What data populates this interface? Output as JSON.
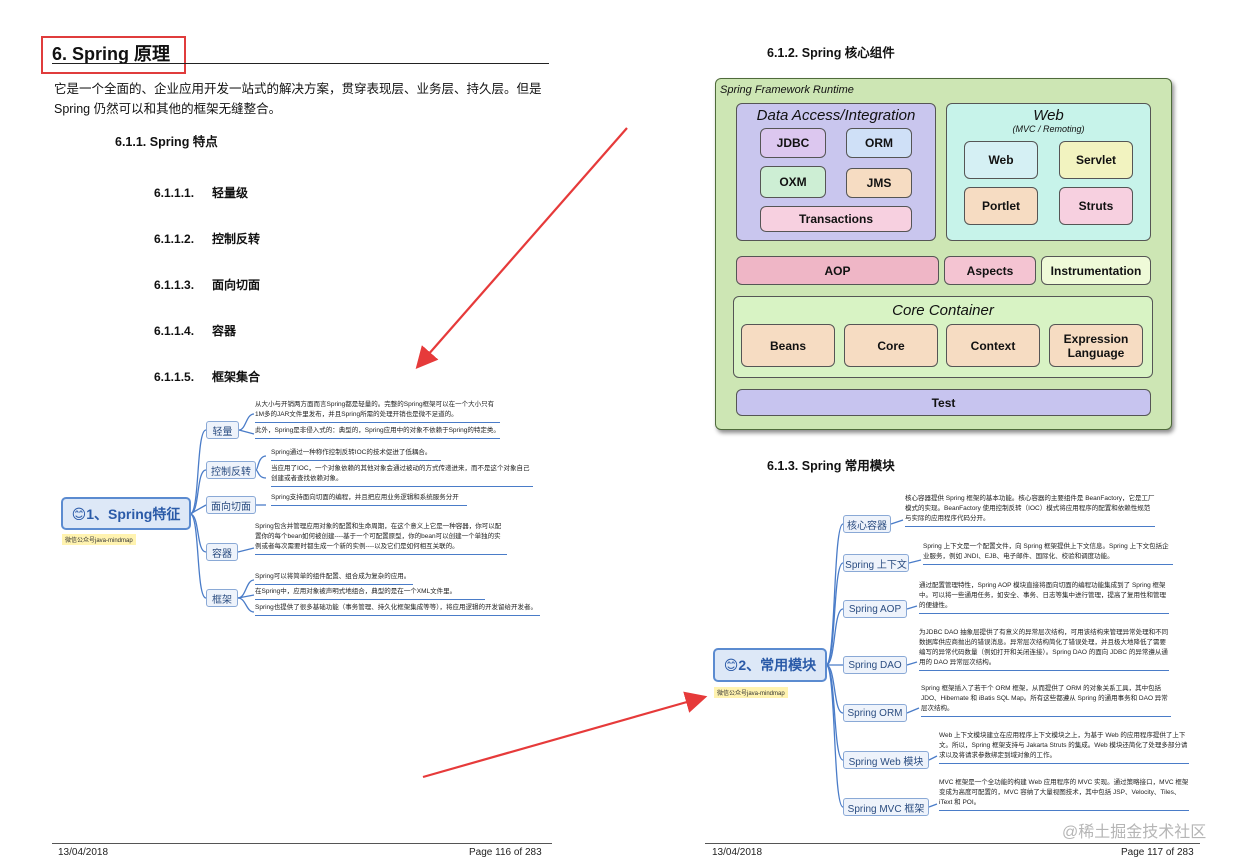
{
  "left_page": {
    "section_title": "6. Spring 原理",
    "intro": "它是一个全面的、企业应用开发一站式的解决方案，贯穿表现层、业务层、持久层。但是 Spring 仍然可以和其他的框架无缝整合。",
    "subsection": "6.1.1.  Spring 特点",
    "features": [
      {
        "num": "6.1.1.1.",
        "label": "轻量级"
      },
      {
        "num": "6.1.1.2.",
        "label": "控制反转"
      },
      {
        "num": "6.1.1.3.",
        "label": "面向切面"
      },
      {
        "num": "6.1.1.4.",
        "label": "容器"
      },
      {
        "num": "6.1.1.5.",
        "label": "框架集合"
      }
    ],
    "mindmap": {
      "root": "😊1、Spring特征",
      "tag": "微信公众号java-mindmap",
      "nodes": [
        {
          "label": "轻量",
          "leaves": [
            "从大小与开销两方面而言Spring都是轻量的。完整的Spring框架可以在一个大小只有1M多的JAR文件里发布，并且Spring所需的处理开销也是微不足道的。",
            "此外，Spring是非侵入式的：典型的，Spring应用中的对象不依赖于Spring的特定类。"
          ]
        },
        {
          "label": "控制反转",
          "leaves": [
            "Spring通过一种称作控制反转IOC的技术促进了低耦合。",
            "当应用了IOC，一个对象依赖的其他对象会通过被动的方式传递进来，而不是这个对象自己创建或者查找依赖对象。"
          ]
        },
        {
          "label": "面向切面",
          "leaves": [
            "Spring支持面向切面的编程，并且把应用业务逻辑和系统服务分开"
          ]
        },
        {
          "label": "容器",
          "leaves": [
            "Spring包含并管理应用对象的配置和生命周期，在这个意义上它是一种容器，你可以配置你的每个bean如何被创建----基于一个可配置原型，你的bean可以创建一个单独的实例或者每次需要时都生成一个新的实例----以及它们是如何相互关联的。"
          ]
        },
        {
          "label": "框架",
          "leaves": [
            "Spring可以将简单的组件配置、组合成为复杂的应用。",
            "在Spring中，应用对象被声明式地组合，典型的是在一个XML文件里。",
            "Spring也提供了很多基础功能（事务管理、持久化框架集成等等），将应用逻辑的开发留给开发者。"
          ]
        }
      ]
    },
    "footer_date": "13/04/2018",
    "footer_page": "Page 116 of 283"
  },
  "right_page": {
    "subsection_components": "6.1.2.  Spring 核心组件",
    "runtime": {
      "title": "Spring Framework Runtime",
      "data_access": {
        "title": "Data Access/Integration",
        "items": [
          "JDBC",
          "ORM",
          "OXM",
          "JMS",
          "Transactions"
        ]
      },
      "web": {
        "title": "Web",
        "subtitle": "(MVC / Remoting)",
        "items": [
          "Web",
          "Servlet",
          "Portlet",
          "Struts"
        ]
      },
      "middle": [
        "AOP",
        "Aspects",
        "Instrumentation"
      ],
      "core": {
        "title": "Core Container",
        "items": [
          "Beans",
          "Core",
          "Context",
          "Expression Language"
        ]
      },
      "test": "Test"
    },
    "subsection_modules": "6.1.3.  Spring 常用模块",
    "mindmap": {
      "root": "😊2、常用模块",
      "tag": "微信公众号java-mindmap",
      "nodes": [
        {
          "label": "核心容器",
          "desc": "核心容器提供 Spring 框架的基本功能。核心容器的主要组件是 BeanFactory，它是工厂模式的实现。BeanFactory 使用控制反转（IOC）模式将应用程序的配置和依赖性规范与实际的应用程序代码分开。"
        },
        {
          "label": "Spring 上下文",
          "desc": "Spring 上下文是一个配置文件，向 Spring 框架提供上下文信息。Spring 上下文包括企业服务，例如 JNDI、EJB、电子邮件、国际化、校验和调度功能。"
        },
        {
          "label": "Spring AOP",
          "desc": "通过配置管理特性，Spring AOP 模块直接将面向切面的编程功能集成到了 Spring 框架中。可以将一些通用任务，如安全、事务、日志等集中进行管理，提高了复用性和管理的便捷性。"
        },
        {
          "label": "Spring DAO",
          "desc": "为JDBC DAO 抽象层提供了有意义的异常层次结构，可用该结构来管理异常处理和不同数据库供应商抛出的错误消息。异常层次结构简化了错误处理，并且极大地降低了需要编写的异常代码数量（例如打开和关闭连接）。Spring DAO 的面向 JDBC 的异常遵从通用的 DAO 异常层次结构。"
        },
        {
          "label": "Spring ORM",
          "desc": "Spring 框架插入了若干个 ORM 框架，从而提供了 ORM 的对象关系工具，其中包括 JDO、Hibernate 和 iBatis SQL Map。所有这些都遵从 Spring 的通用事务和 DAO 异常层次结构。"
        },
        {
          "label": "Spring Web 模块",
          "desc": "Web 上下文模块建立在应用程序上下文模块之上，为基于 Web 的应用程序提供了上下文。所以，Spring 框架支持与 Jakarta Struts 的集成。Web 模块还简化了处理多部分请求以及将请求参数绑定到域对象的工作。"
        },
        {
          "label": "Spring MVC 框架",
          "desc": "MVC 框架是一个全功能的构建 Web 应用程序的 MVC 实现。通过策略接口，MVC 框架变成为高度可配置的，MVC 容纳了大量视图技术，其中包括 JSP、Velocity、Tiles、iText 和 POI。"
        }
      ]
    },
    "footer_date": "13/04/2018",
    "footer_page": "Page 117 of 283"
  },
  "watermark": "@稀土掘金技术社区",
  "colors": {
    "highlight_box": "#e03c3c",
    "arrow": "#e63a3a",
    "runtime_bg": "#cde6b4",
    "data_access": "#c9c6ee",
    "web": "#c7f3ea",
    "aop": "#efb6c6",
    "test": "#c7c4ef",
    "beans": "#f6dcc2"
  }
}
